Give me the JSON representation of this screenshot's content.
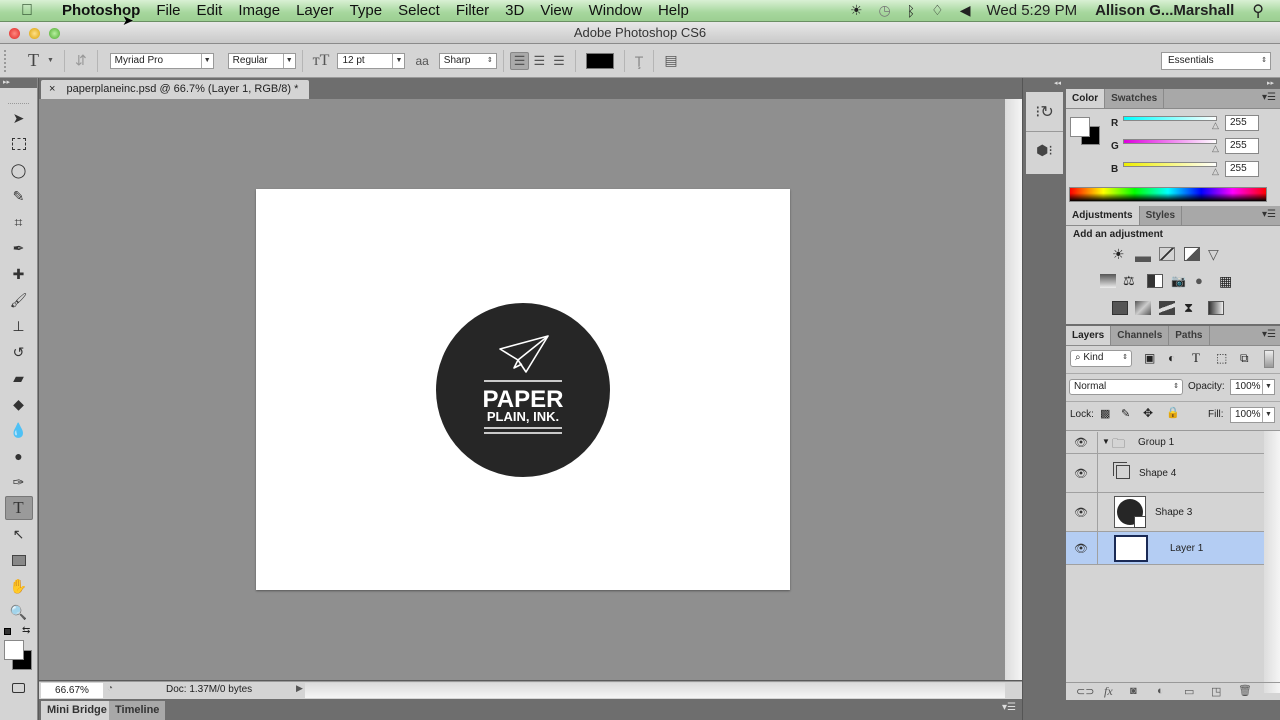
{
  "menubar": {
    "apple_icon": "",
    "items": [
      "Photoshop",
      "File",
      "Edit",
      "Image",
      "Layer",
      "Type",
      "Select",
      "Filter",
      "3D",
      "View",
      "Window",
      "Help"
    ],
    "clock": "Wed 5:29 PM",
    "user": "Allison G...Marshall"
  },
  "window": {
    "title": "Adobe Photoshop CS6"
  },
  "options_bar": {
    "font_family": "Myriad Pro",
    "font_style": "Regular",
    "font_size": "12 pt",
    "antialias_icon": "aa",
    "antialias": "Sharp",
    "text_color": "#000000",
    "workspace": "Essentials"
  },
  "document": {
    "tab_title": "paperplaneinc.psd @ 66.7% (Layer 1, RGB/8) *",
    "close_glyph": "×",
    "logo_line1": "PAPER",
    "logo_line2": "PLAIN, INK.",
    "logo_color": "#262626"
  },
  "status_bar": {
    "zoom": "66.67%",
    "doc_info": "Doc: 1.37M/0 bytes"
  },
  "bottom_tabs": [
    "Mini Bridge",
    "Timeline"
  ],
  "color_panel": {
    "tabs": [
      "Color",
      "Swatches"
    ],
    "channels": [
      {
        "label": "R",
        "value": "255"
      },
      {
        "label": "G",
        "value": "255"
      },
      {
        "label": "B",
        "value": "255"
      }
    ],
    "foreground": "#ffffff",
    "background": "#000000"
  },
  "adjustments_panel": {
    "tabs": [
      "Adjustments",
      "Styles"
    ],
    "heading": "Add an adjustment"
  },
  "layers_panel": {
    "tabs": [
      "Layers",
      "Channels",
      "Paths"
    ],
    "filter_kind": "Kind",
    "blend_mode": "Normal",
    "opacity_label": "Opacity:",
    "opacity": "100%",
    "lock_label": "Lock:",
    "fill_label": "Fill:",
    "fill": "100%",
    "layers": [
      {
        "name": "Group 1",
        "type": "group",
        "selected": false
      },
      {
        "name": "Shape 4",
        "type": "shape",
        "selected": false
      },
      {
        "name": "Shape 3",
        "type": "shape",
        "selected": false
      },
      {
        "name": "Layer 1",
        "type": "pixel",
        "selected": true
      }
    ]
  }
}
